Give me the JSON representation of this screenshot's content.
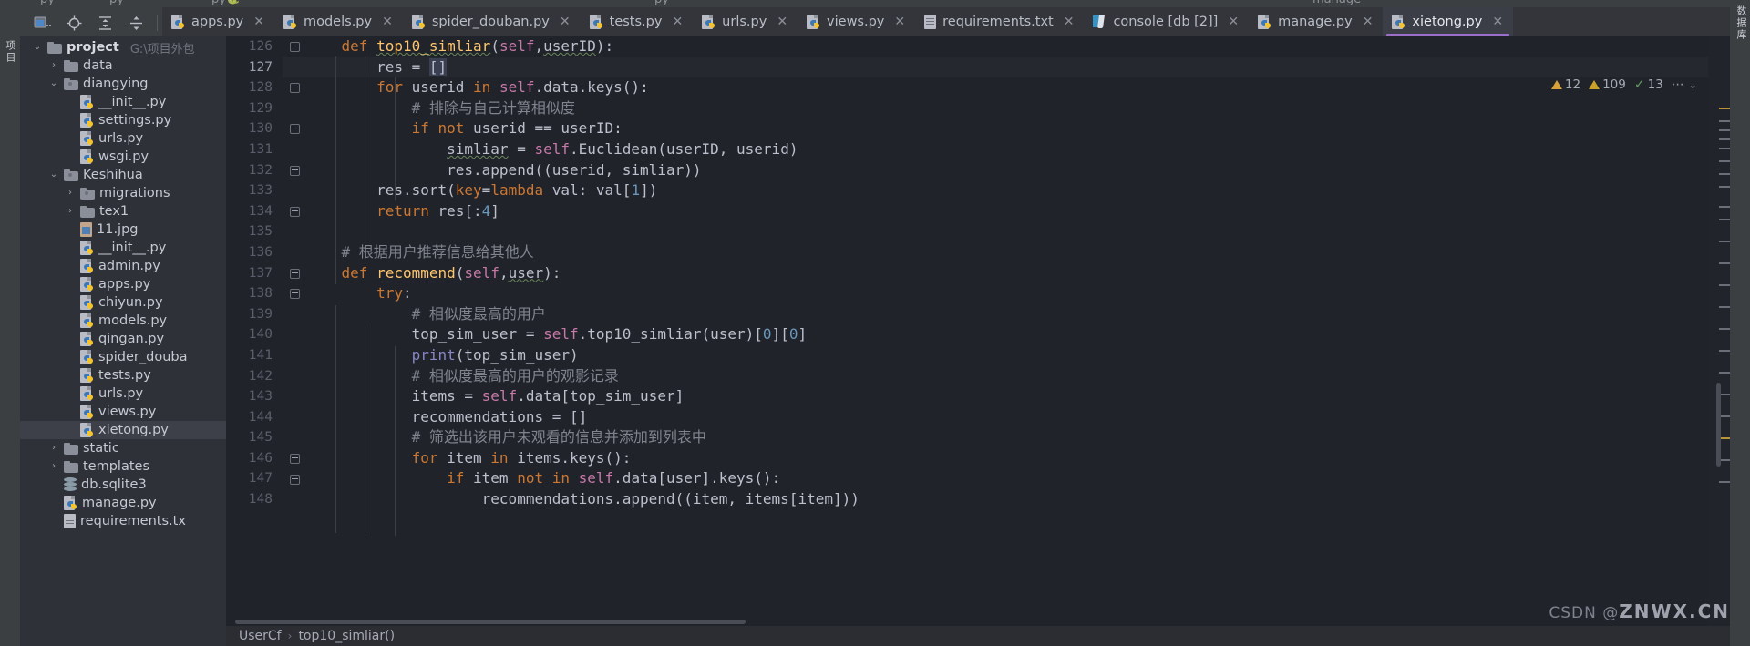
{
  "window": {
    "ghost_tabs": [
      "py",
      "py",
      "py"
    ],
    "ghost_toolbar_label": "manage",
    "left_rail_label": "项目",
    "right_rail_label": "数据库"
  },
  "toolbar": {
    "buttons": [
      {
        "name": "open-file-icon",
        "glyph": "▱.."
      },
      {
        "name": "target-icon",
        "glyph": "⊕"
      },
      {
        "name": "expand-all-icon",
        "glyph": "⇅"
      },
      {
        "name": "collapse-all-icon",
        "glyph": "⇵"
      },
      {
        "name": "settings-gear-icon",
        "glyph": "⚙"
      }
    ]
  },
  "tabs": [
    {
      "label": "apps.py",
      "icon": "python-file-icon",
      "active": false
    },
    {
      "label": "models.py",
      "icon": "python-file-icon",
      "active": false
    },
    {
      "label": "spider_douban.py",
      "icon": "python-file-icon",
      "active": false
    },
    {
      "label": "tests.py",
      "icon": "python-file-icon",
      "active": false
    },
    {
      "label": "urls.py",
      "icon": "python-file-icon",
      "active": false
    },
    {
      "label": "views.py",
      "icon": "python-file-icon",
      "active": false
    },
    {
      "label": "requirements.txt",
      "icon": "text-file-icon",
      "active": false
    },
    {
      "label": "console [db [2]]",
      "icon": "console-icon",
      "active": false
    },
    {
      "label": "manage.py",
      "icon": "python-file-icon",
      "active": false
    },
    {
      "label": "xietong.py",
      "icon": "python-file-icon",
      "active": true
    }
  ],
  "tab_close_glyph": "✕",
  "project_tree": [
    {
      "label": "project",
      "path": "G:\\项目外包",
      "indent": 0,
      "chev": "v",
      "icon": "folder-icon",
      "bold": true,
      "selected": false
    },
    {
      "label": "data",
      "indent": 1,
      "chev": ">",
      "icon": "folder-icon",
      "selected": false
    },
    {
      "label": "diangying",
      "indent": 1,
      "chev": "v",
      "icon": "folder-module-icon",
      "selected": false
    },
    {
      "label": "__init__.py",
      "indent": 2,
      "chev": "",
      "icon": "python-file-icon",
      "selected": false
    },
    {
      "label": "settings.py",
      "indent": 2,
      "chev": "",
      "icon": "python-file-icon",
      "selected": false
    },
    {
      "label": "urls.py",
      "indent": 2,
      "chev": "",
      "icon": "python-file-icon",
      "selected": false
    },
    {
      "label": "wsgi.py",
      "indent": 2,
      "chev": "",
      "icon": "python-file-icon",
      "selected": false
    },
    {
      "label": "Keshihua",
      "indent": 1,
      "chev": "v",
      "icon": "folder-module-icon",
      "selected": false
    },
    {
      "label": "migrations",
      "indent": 2,
      "chev": ">",
      "icon": "folder-module-icon",
      "selected": false
    },
    {
      "label": "tex1",
      "indent": 2,
      "chev": ">",
      "icon": "folder-icon",
      "selected": false
    },
    {
      "label": "11.jpg",
      "indent": 2,
      "chev": "",
      "icon": "image-file-icon",
      "selected": false
    },
    {
      "label": "__init__.py",
      "indent": 2,
      "chev": "",
      "icon": "python-file-icon",
      "selected": false
    },
    {
      "label": "admin.py",
      "indent": 2,
      "chev": "",
      "icon": "python-file-icon",
      "selected": false
    },
    {
      "label": "apps.py",
      "indent": 2,
      "chev": "",
      "icon": "python-file-icon",
      "selected": false
    },
    {
      "label": "chiyun.py",
      "indent": 2,
      "chev": "",
      "icon": "python-file-icon",
      "selected": false
    },
    {
      "label": "models.py",
      "indent": 2,
      "chev": "",
      "icon": "python-file-icon",
      "selected": false
    },
    {
      "label": "qingan.py",
      "indent": 2,
      "chev": "",
      "icon": "python-file-icon",
      "selected": false
    },
    {
      "label": "spider_douba",
      "indent": 2,
      "chev": "",
      "icon": "python-file-icon",
      "selected": false
    },
    {
      "label": "tests.py",
      "indent": 2,
      "chev": "",
      "icon": "python-file-icon",
      "selected": false
    },
    {
      "label": "urls.py",
      "indent": 2,
      "chev": "",
      "icon": "python-file-icon",
      "selected": false
    },
    {
      "label": "views.py",
      "indent": 2,
      "chev": "",
      "icon": "python-file-icon",
      "selected": false
    },
    {
      "label": "xietong.py",
      "indent": 2,
      "chev": "",
      "icon": "python-file-icon",
      "selected": true
    },
    {
      "label": "static",
      "indent": 1,
      "chev": ">",
      "icon": "folder-icon",
      "selected": false
    },
    {
      "label": "templates",
      "indent": 1,
      "chev": ">",
      "icon": "folder-icon",
      "selected": false
    },
    {
      "label": "db.sqlite3",
      "indent": 1,
      "chev": "",
      "icon": "db-file-icon",
      "selected": false
    },
    {
      "label": "manage.py",
      "indent": 1,
      "chev": "",
      "icon": "python-file-icon",
      "selected": false
    },
    {
      "label": "requirements.tx",
      "indent": 1,
      "chev": "",
      "icon": "text-file-icon",
      "selected": false
    }
  ],
  "editor": {
    "first_line": 126,
    "caret_line": 127,
    "lines": [
      {
        "n": 126,
        "fold": "start",
        "tokens": [
          {
            "t": "    ",
            "c": "pa"
          },
          {
            "t": "def",
            "c": "kd"
          },
          {
            "t": " ",
            "c": "pa"
          },
          {
            "t": "top10_simliar",
            "c": "fn wavy"
          },
          {
            "t": "(",
            "c": "pa"
          },
          {
            "t": "self",
            "c": "se"
          },
          {
            "t": ",",
            "c": "pa"
          },
          {
            "t": "userID",
            "c": "pa wavy2"
          },
          {
            "t": "):",
            "c": "pa"
          }
        ]
      },
      {
        "n": 127,
        "fold": "",
        "tokens": [
          {
            "t": "        ",
            "c": "pa"
          },
          {
            "t": "res ",
            "c": "pa"
          },
          {
            "t": "= ",
            "c": "pa"
          },
          {
            "t": "[]",
            "c": "pa sel"
          }
        ]
      },
      {
        "n": 128,
        "fold": "start",
        "tokens": [
          {
            "t": "        ",
            "c": "pa"
          },
          {
            "t": "for",
            "c": "k"
          },
          {
            "t": " userid ",
            "c": "pa"
          },
          {
            "t": "in",
            "c": "k"
          },
          {
            "t": " ",
            "c": "pa"
          },
          {
            "t": "self",
            "c": "se"
          },
          {
            "t": ".data.keys():",
            "c": "pa"
          }
        ]
      },
      {
        "n": 129,
        "fold": "",
        "tokens": [
          {
            "t": "            ",
            "c": "pa"
          },
          {
            "t": "# 排除与自己计算相似度",
            "c": "cm"
          }
        ]
      },
      {
        "n": 130,
        "fold": "start",
        "tokens": [
          {
            "t": "            ",
            "c": "pa"
          },
          {
            "t": "if",
            "c": "k"
          },
          {
            "t": " ",
            "c": "pa"
          },
          {
            "t": "not",
            "c": "k"
          },
          {
            "t": " userid == userID:",
            "c": "pa"
          }
        ]
      },
      {
        "n": 131,
        "fold": "",
        "tokens": [
          {
            "t": "                ",
            "c": "pa"
          },
          {
            "t": "simliar",
            "c": "pa wavy"
          },
          {
            "t": " = ",
            "c": "pa"
          },
          {
            "t": "self",
            "c": "se"
          },
          {
            "t": ".Euclidean(userID, userid)",
            "c": "pa"
          }
        ]
      },
      {
        "n": 132,
        "fold": "end",
        "tokens": [
          {
            "t": "                ",
            "c": "pa"
          },
          {
            "t": "res.append((userid, simliar))",
            "c": "pa"
          }
        ]
      },
      {
        "n": 133,
        "fold": "",
        "tokens": [
          {
            "t": "        ",
            "c": "pa"
          },
          {
            "t": "res.sort(",
            "c": "pa"
          },
          {
            "t": "key",
            "c": "k"
          },
          {
            "t": "=",
            "c": "pa"
          },
          {
            "t": "lambda",
            "c": "k"
          },
          {
            "t": " val: val[",
            "c": "pa"
          },
          {
            "t": "1",
            "c": "nu"
          },
          {
            "t": "])",
            "c": "pa"
          }
        ]
      },
      {
        "n": 134,
        "fold": "end",
        "tokens": [
          {
            "t": "        ",
            "c": "pa"
          },
          {
            "t": "return",
            "c": "kd"
          },
          {
            "t": " res[:",
            "c": "pa"
          },
          {
            "t": "4",
            "c": "nu"
          },
          {
            "t": "]",
            "c": "pa"
          }
        ]
      },
      {
        "n": 135,
        "fold": "",
        "tokens": []
      },
      {
        "n": 136,
        "fold": "",
        "tokens": [
          {
            "t": "    ",
            "c": "pa"
          },
          {
            "t": "# 根据用户推荐信息给其他人",
            "c": "cm"
          }
        ]
      },
      {
        "n": 137,
        "fold": "start",
        "tokens": [
          {
            "t": "    ",
            "c": "pa"
          },
          {
            "t": "def",
            "c": "kd"
          },
          {
            "t": " ",
            "c": "pa"
          },
          {
            "t": "recommend",
            "c": "fn"
          },
          {
            "t": "(",
            "c": "pa"
          },
          {
            "t": "self",
            "c": "se"
          },
          {
            "t": ",",
            "c": "pa"
          },
          {
            "t": "user",
            "c": "pa wavy2"
          },
          {
            "t": "):",
            "c": "pa"
          }
        ]
      },
      {
        "n": 138,
        "fold": "start",
        "tokens": [
          {
            "t": "        ",
            "c": "pa"
          },
          {
            "t": "try",
            "c": "k"
          },
          {
            "t": ":",
            "c": "pa"
          }
        ]
      },
      {
        "n": 139,
        "fold": "",
        "tokens": [
          {
            "t": "            ",
            "c": "pa"
          },
          {
            "t": "# 相似度最高的用户",
            "c": "cm"
          }
        ]
      },
      {
        "n": 140,
        "fold": "",
        "tokens": [
          {
            "t": "            ",
            "c": "pa"
          },
          {
            "t": "top_sim_user = ",
            "c": "pa"
          },
          {
            "t": "self",
            "c": "se"
          },
          {
            "t": ".top10_simliar(user)[",
            "c": "pa"
          },
          {
            "t": "0",
            "c": "nu"
          },
          {
            "t": "][",
            "c": "pa"
          },
          {
            "t": "0",
            "c": "nu"
          },
          {
            "t": "]",
            "c": "pa"
          }
        ]
      },
      {
        "n": 141,
        "fold": "",
        "tokens": [
          {
            "t": "            ",
            "c": "pa"
          },
          {
            "t": "print",
            "c": "bi"
          },
          {
            "t": "(top_sim_user)",
            "c": "pa"
          }
        ]
      },
      {
        "n": 142,
        "fold": "",
        "tokens": [
          {
            "t": "            ",
            "c": "pa"
          },
          {
            "t": "# 相似度最高的用户的观影记录",
            "c": "cm"
          }
        ]
      },
      {
        "n": 143,
        "fold": "",
        "tokens": [
          {
            "t": "            ",
            "c": "pa"
          },
          {
            "t": "items = ",
            "c": "pa"
          },
          {
            "t": "self",
            "c": "se"
          },
          {
            "t": ".data[top_sim_user]",
            "c": "pa"
          }
        ]
      },
      {
        "n": 144,
        "fold": "",
        "tokens": [
          {
            "t": "            ",
            "c": "pa"
          },
          {
            "t": "recommendations = []",
            "c": "pa"
          }
        ]
      },
      {
        "n": 145,
        "fold": "",
        "tokens": [
          {
            "t": "            ",
            "c": "pa"
          },
          {
            "t": "# 筛选出该用户未观看的信息并添加到列表中",
            "c": "cm"
          }
        ]
      },
      {
        "n": 146,
        "fold": "start",
        "tokens": [
          {
            "t": "            ",
            "c": "pa"
          },
          {
            "t": "for",
            "c": "k"
          },
          {
            "t": " item ",
            "c": "pa"
          },
          {
            "t": "in",
            "c": "k"
          },
          {
            "t": " items.keys():",
            "c": "pa"
          }
        ]
      },
      {
        "n": 147,
        "fold": "start",
        "tokens": [
          {
            "t": "                ",
            "c": "pa"
          },
          {
            "t": "if",
            "c": "k"
          },
          {
            "t": " item ",
            "c": "pa"
          },
          {
            "t": "not",
            "c": "k"
          },
          {
            "t": " ",
            "c": "pa"
          },
          {
            "t": "in",
            "c": "k"
          },
          {
            "t": " ",
            "c": "pa"
          },
          {
            "t": "self",
            "c": "se"
          },
          {
            "t": ".data[user].keys():",
            "c": "pa"
          }
        ]
      },
      {
        "n": 148,
        "fold": "",
        "tokens": [
          {
            "t": "                    ",
            "c": "pa"
          },
          {
            "t": "recommendations.append((item, items[item]))",
            "c": "pa"
          }
        ]
      }
    ]
  },
  "inspections": {
    "warning_count": "12",
    "weak_warning_count": "109",
    "ok_count": "13",
    "more_glyph": "⋯",
    "chevron_glyph": "⌄"
  },
  "breadcrumb": {
    "class_name": "UserCf",
    "separator": "›",
    "method_name": "top10_simliar()"
  },
  "watermark": {
    "prefix": "CSDN @",
    "text": "ZNWX.CN"
  },
  "colors": {
    "accent_tab_underline": "#9b6fc9",
    "editor_bg": "#21232a",
    "sidebar_bg": "#2f3138",
    "chrome_bg": "#3c3f41",
    "keyword": "#cc7832",
    "function": "#ffc66d",
    "self": "#c678a8",
    "comment": "#7f848e",
    "number": "#6897bb",
    "builtin": "#8888c6",
    "warning": "#d6a138",
    "ok": "#5c9e5c"
  }
}
